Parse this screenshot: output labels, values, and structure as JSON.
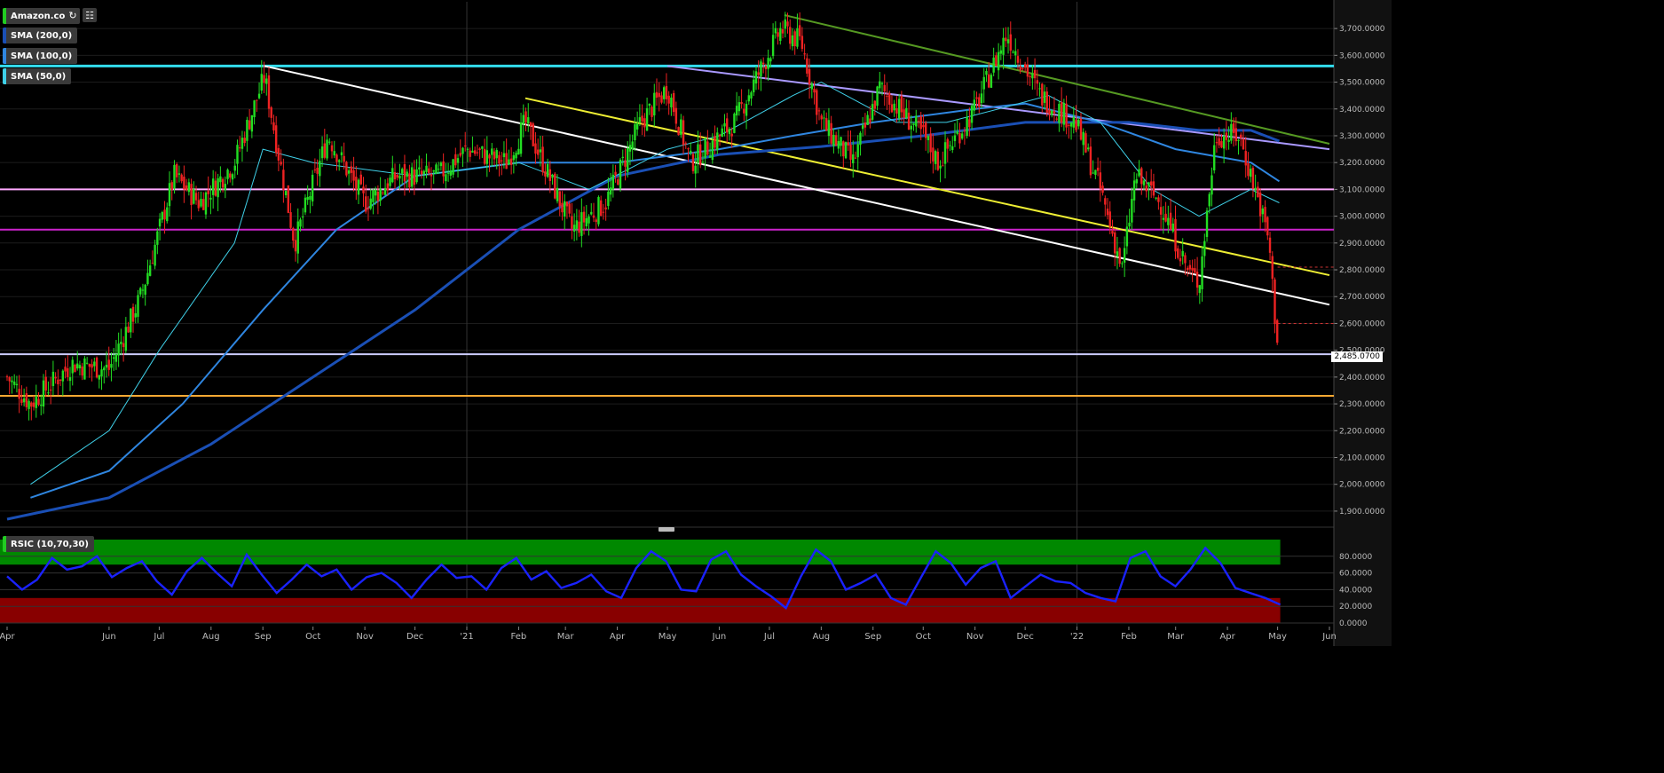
{
  "toolbar": {
    "symbol": "Amazon.com",
    "refresh_icon": "refresh-icon",
    "chart_type_icon": "bar-chart-icon"
  },
  "legend": [
    {
      "label": "SMA (200,0)",
      "color": "#1a4fb5"
    },
    {
      "label": "SMA (100,0)",
      "color": "#2f86e0"
    },
    {
      "label": "SMA (50,0)",
      "color": "#3fd0e8"
    }
  ],
  "rsi_label": "RSIC (10,70,30)",
  "current_price_label": "2,485.0700",
  "colors": {
    "up": "#22dd22",
    "down": "#ee2222",
    "overbought_zone": "#008800",
    "oversold_zone": "#880000",
    "rsi_line": "#1a22ff"
  },
  "chart_data": [
    {
      "type": "candlestick",
      "title": "Amazon.com",
      "y_ticks": [
        "1,900.0000",
        "2,000.0000",
        "2,100.0000",
        "2,200.0000",
        "2,300.0000",
        "2,400.0000",
        "2,500.0000",
        "2,600.0000",
        "2,700.0000",
        "2,800.0000",
        "2,900.0000",
        "3,000.0000",
        "3,100.0000",
        "3,200.0000",
        "3,300.0000",
        "3,400.0000",
        "3,500.0000",
        "3,600.0000",
        "3,700.0000"
      ],
      "ylim": [
        1860,
        3760
      ],
      "x_ticks": [
        "Apr",
        "Jun",
        "Jul",
        "Aug",
        "Sep",
        "Oct",
        "Nov",
        "Dec",
        "'21",
        "Feb",
        "Mar",
        "Apr",
        "May",
        "Jun",
        "Jul",
        "Aug",
        "Sep",
        "Oct",
        "Nov",
        "Dec",
        "'22",
        "Feb",
        "Mar",
        "Apr",
        "May",
        "Jun"
      ],
      "horizontal_lines": [
        {
          "price": 3560,
          "color": "#33ddee"
        },
        {
          "price": 3100,
          "color": "#ffaaff"
        },
        {
          "price": 2950,
          "color": "#cc22cc"
        },
        {
          "price": 2485,
          "color": "#ccccff"
        },
        {
          "price": 2330,
          "color": "#ffaa33"
        }
      ],
      "close_path": [
        [
          "2020-04-01",
          2400
        ],
        [
          "2020-04-15",
          2300
        ],
        [
          "2020-05-10",
          2450
        ],
        [
          "2020-06-01",
          2430
        ],
        [
          "2020-06-20",
          2700
        ],
        [
          "2020-07-10",
          3150
        ],
        [
          "2020-07-25",
          3050
        ],
        [
          "2020-08-15",
          3200
        ],
        [
          "2020-09-02",
          3520
        ],
        [
          "2020-09-20",
          2900
        ],
        [
          "2020-10-10",
          3300
        ],
        [
          "2020-11-01",
          3050
        ],
        [
          "2020-11-20",
          3150
        ],
        [
          "2020-12-15",
          3150
        ],
        [
          "2021-01-01",
          3250
        ],
        [
          "2021-01-25",
          3200
        ],
        [
          "2021-02-05",
          3350
        ],
        [
          "2021-03-05",
          2950
        ],
        [
          "2021-03-25",
          3050
        ],
        [
          "2021-04-15",
          3350
        ],
        [
          "2021-05-01",
          3480
        ],
        [
          "2021-05-15",
          3200
        ],
        [
          "2021-06-10",
          3350
        ],
        [
          "2021-07-08",
          3700
        ],
        [
          "2021-07-20",
          3650
        ],
        [
          "2021-08-01",
          3350
        ],
        [
          "2021-08-20",
          3200
        ],
        [
          "2021-09-05",
          3480
        ],
        [
          "2021-10-01",
          3300
        ],
        [
          "2021-10-10",
          3200
        ],
        [
          "2021-11-01",
          3400
        ],
        [
          "2021-11-20",
          3680
        ],
        [
          "2021-12-10",
          3450
        ],
        [
          "2021-12-31",
          3350
        ],
        [
          "2022-01-15",
          3100
        ],
        [
          "2022-01-28",
          2800
        ],
        [
          "2022-02-05",
          3150
        ],
        [
          "2022-02-20",
          3050
        ],
        [
          "2022-03-08",
          2800
        ],
        [
          "2022-03-15",
          2750
        ],
        [
          "2022-03-25",
          3300
        ],
        [
          "2022-04-08",
          3300
        ],
        [
          "2022-04-20",
          3050
        ],
        [
          "2022-04-26",
          2900
        ],
        [
          "2022-04-29",
          2650
        ],
        [
          "2022-05-02",
          2485
        ]
      ],
      "sma_50": [
        [
          "2020-04-15",
          2000
        ],
        [
          "2020-06-01",
          2200
        ],
        [
          "2020-07-01",
          2500
        ],
        [
          "2020-08-15",
          2900
        ],
        [
          "2020-09-01",
          3250
        ],
        [
          "2020-10-01",
          3200
        ],
        [
          "2020-12-01",
          3150
        ],
        [
          "2021-02-01",
          3200
        ],
        [
          "2021-03-15",
          3100
        ],
        [
          "2021-05-01",
          3250
        ],
        [
          "2021-06-01",
          3300
        ],
        [
          "2021-07-15",
          3450
        ],
        [
          "2021-08-01",
          3500
        ],
        [
          "2021-09-15",
          3350
        ],
        [
          "2021-10-15",
          3350
        ],
        [
          "2021-11-15",
          3400
        ],
        [
          "2021-12-15",
          3450
        ],
        [
          "2022-01-15",
          3350
        ],
        [
          "2022-02-15",
          3100
        ],
        [
          "2022-03-15",
          3000
        ],
        [
          "2022-04-15",
          3100
        ],
        [
          "2022-05-02",
          3050
        ]
      ],
      "sma_100": [
        [
          "2020-04-15",
          1950
        ],
        [
          "2020-06-01",
          2050
        ],
        [
          "2020-07-15",
          2300
        ],
        [
          "2020-09-01",
          2650
        ],
        [
          "2020-10-15",
          2950
        ],
        [
          "2020-12-01",
          3150
        ],
        [
          "2021-02-01",
          3200
        ],
        [
          "2021-04-01",
          3200
        ],
        [
          "2021-06-01",
          3250
        ],
        [
          "2021-07-15",
          3300
        ],
        [
          "2021-09-01",
          3350
        ],
        [
          "2021-11-01",
          3400
        ],
        [
          "2021-12-01",
          3420
        ],
        [
          "2022-01-15",
          3350
        ],
        [
          "2022-03-01",
          3250
        ],
        [
          "2022-04-15",
          3200
        ],
        [
          "2022-05-02",
          3130
        ]
      ],
      "sma_200": [
        [
          "2020-04-01",
          1870
        ],
        [
          "2020-06-01",
          1950
        ],
        [
          "2020-08-01",
          2150
        ],
        [
          "2020-10-01",
          2400
        ],
        [
          "2020-12-01",
          2650
        ],
        [
          "2021-02-01",
          2950
        ],
        [
          "2021-04-01",
          3150
        ],
        [
          "2021-06-01",
          3230
        ],
        [
          "2021-08-01",
          3260
        ],
        [
          "2021-10-01",
          3300
        ],
        [
          "2021-12-01",
          3350
        ],
        [
          "2022-02-01",
          3350
        ],
        [
          "2022-03-15",
          3320
        ],
        [
          "2022-04-15",
          3320
        ],
        [
          "2022-05-02",
          3280
        ]
      ]
    },
    {
      "type": "line",
      "title": "RSIC (10,70,30)",
      "y_ticks": [
        "0.0000",
        "20.0000",
        "40.0000",
        "60.0000",
        "80.0000"
      ],
      "ylim": [
        0,
        100
      ],
      "overbought": 70,
      "oversold": 30,
      "values": [
        56,
        40,
        52,
        78,
        64,
        68,
        80,
        55,
        66,
        74,
        50,
        34,
        62,
        78,
        60,
        44,
        82,
        58,
        36,
        52,
        70,
        56,
        64,
        40,
        55,
        60,
        48,
        30,
        52,
        70,
        54,
        56,
        40,
        66,
        78,
        52,
        62,
        42,
        48,
        58,
        38,
        30,
        66,
        86,
        74,
        40,
        38,
        76,
        86,
        58,
        44,
        32,
        18,
        56,
        88,
        74,
        40,
        48,
        58,
        30,
        22,
        54,
        86,
        72,
        46,
        66,
        74,
        30,
        44,
        58,
        50,
        48,
        36,
        30,
        26,
        78,
        86,
        56,
        44,
        64,
        90,
        72,
        42,
        36,
        30,
        22
      ]
    }
  ]
}
